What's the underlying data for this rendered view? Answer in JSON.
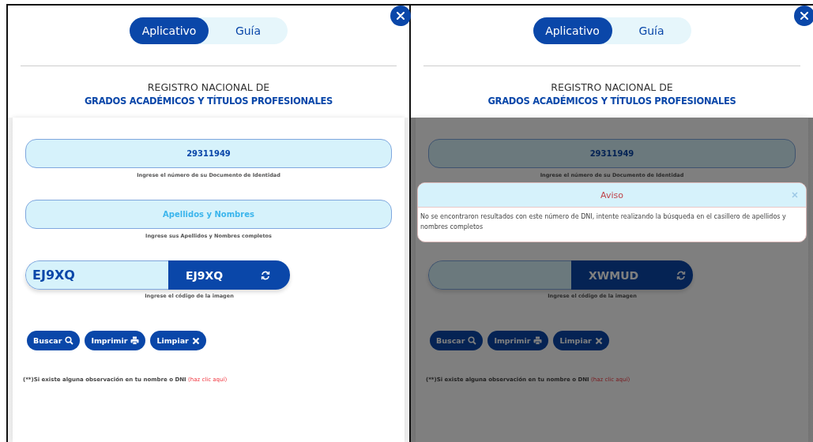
{
  "panels": [
    {
      "tabs": [
        {
          "label": "Aplicativo",
          "selected": true
        },
        {
          "label": "Guía",
          "selected": false
        }
      ],
      "heading": {
        "line1": "REGISTRO NACIONAL DE",
        "line2": "GRADOS ACADÉMICOS Y TÍTULOS PROFESIONALES"
      },
      "fields": [
        {
          "value": "29311949",
          "hint": "Ingrese el número de su Documento de Identidad"
        },
        {
          "placeholder": "Apellidos y Nombres",
          "hint": "Ingrese sus Apellidos y Nombres completos"
        }
      ],
      "captcha": {
        "value": "EJ9XQ",
        "code": "EJ9XQ",
        "hint": "Ingrese el código de la imagen"
      },
      "buttons": [
        {
          "label": "Buscar",
          "kind": "search"
        },
        {
          "label": "Imprimir",
          "kind": "print"
        },
        {
          "label": "Limpiar",
          "kind": "clear"
        }
      ],
      "note": {
        "text": "(**)Si existe alguna observación en tu nombre o DNI",
        "link": "(haz clic aquí)"
      }
    },
    {
      "tabs": [
        {
          "label": "Aplicativo",
          "selected": true
        },
        {
          "label": "Guía",
          "selected": false
        }
      ],
      "heading": {
        "line1": "REGISTRO NACIONAL DE",
        "line2": "GRADOS ACADÉMICOS Y TÍTULOS PROFESIONALES"
      },
      "fields": [
        {
          "value": "29311949",
          "hint": "Ingrese el número de su Documento de Identidad"
        }
      ],
      "captcha": {
        "code": "XWMUD",
        "hint": "Ingrese el código de la imagen"
      },
      "buttons": [
        {
          "label": "Buscar",
          "kind": "search"
        },
        {
          "label": "Imprimir",
          "kind": "print"
        },
        {
          "label": "Limpiar",
          "kind": "clear"
        }
      ],
      "note": {
        "text": "(**)Si existe alguna observación en tu nombre o DNI",
        "link": "(haz clic aquí)"
      },
      "alert": {
        "title": "Aviso",
        "message": "No se encontraron resultados con este número de DNI, intente realizando la búsqueda en el casillero de apellidos y nombres completos"
      }
    }
  ]
}
